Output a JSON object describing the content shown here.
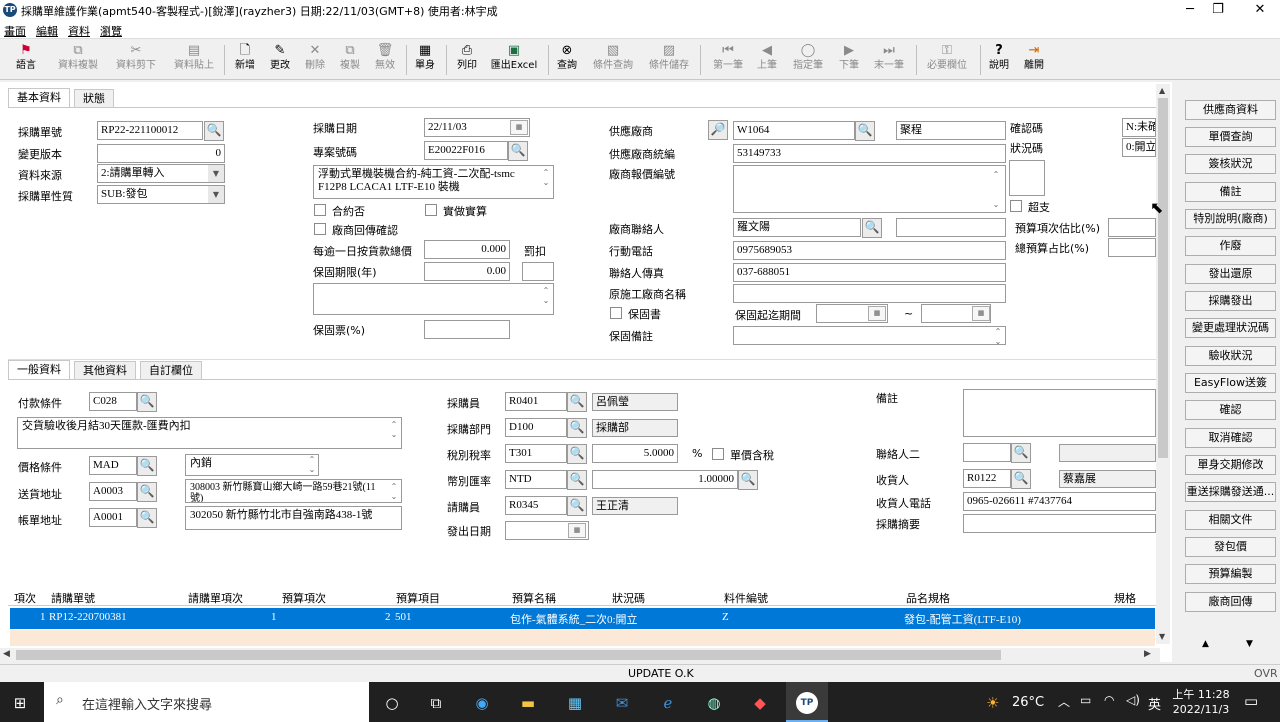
{
  "window": {
    "title": "採購單維護作業(apmt540-客製程式-)[銳澤](rayzher3) 日期:22/11/03(GMT+8) 使用者:林宇成",
    "app_icon": "TP",
    "minimize": "─",
    "maximize": "❐",
    "close": "✕"
  },
  "menu": [
    "畫面",
    "編輯",
    "資料",
    "瀏覽"
  ],
  "toolbar": [
    {
      "label": "語言",
      "icon": "flag-icon",
      "glyph": "⚑",
      "disabled": false
    },
    {
      "label": "資料複製",
      "icon": "copy-icon",
      "glyph": "⧉",
      "disabled": true
    },
    {
      "label": "資料剪下",
      "icon": "scissors-icon",
      "glyph": "✂",
      "disabled": true
    },
    {
      "label": "資料貼上",
      "icon": "paste-icon",
      "glyph": "▤",
      "disabled": true
    },
    {
      "label": "新增",
      "icon": "new-doc-icon",
      "glyph": "🗋",
      "disabled": false
    },
    {
      "label": "更改",
      "icon": "pencil-icon",
      "glyph": "✎",
      "disabled": false
    },
    {
      "label": "刪除",
      "icon": "delete-x-icon",
      "glyph": "✕",
      "disabled": true
    },
    {
      "label": "複製",
      "icon": "duplicate-icon",
      "glyph": "⧉",
      "disabled": true
    },
    {
      "label": "無效",
      "icon": "trash-icon",
      "glyph": "🗑",
      "disabled": true
    },
    {
      "label": "單身",
      "icon": "detail-icon",
      "glyph": "▦",
      "disabled": false
    },
    {
      "label": "列印",
      "icon": "printer-icon",
      "glyph": "⎙",
      "disabled": false
    },
    {
      "label": "匯出Excel",
      "icon": "excel-icon",
      "glyph": "▣",
      "disabled": false
    },
    {
      "label": "查詢",
      "icon": "binoculars-icon",
      "glyph": "⊗",
      "disabled": false
    },
    {
      "label": "條件查詢",
      "icon": "filter-search-icon",
      "glyph": "▧",
      "disabled": true
    },
    {
      "label": "條件儲存",
      "icon": "filter-save-icon",
      "glyph": "▨",
      "disabled": true
    },
    {
      "label": "第一筆",
      "icon": "first-record-icon",
      "glyph": "⏮",
      "disabled": true
    },
    {
      "label": "上筆",
      "icon": "previous-record-icon",
      "glyph": "◀",
      "disabled": true
    },
    {
      "label": "指定筆",
      "icon": "goto-record-icon",
      "glyph": "◯",
      "disabled": true
    },
    {
      "label": "下筆",
      "icon": "next-record-icon",
      "glyph": "▶",
      "disabled": true
    },
    {
      "label": "末一筆",
      "icon": "last-record-icon",
      "glyph": "⏭",
      "disabled": true
    },
    {
      "label": "必要欄位",
      "icon": "key-icon",
      "glyph": "⚿",
      "disabled": true
    },
    {
      "label": "說明",
      "icon": "help-icon",
      "glyph": "?",
      "disabled": false
    },
    {
      "label": "離開",
      "icon": "exit-icon",
      "glyph": "⇥",
      "disabled": false
    }
  ],
  "tabs_top": [
    "基本資料",
    "狀態"
  ],
  "tabs_mid": [
    "一般資料",
    "其他資料",
    "自訂欄位"
  ],
  "form": {
    "po_no_label": "採購單號",
    "po_no": "RP22-221100012",
    "version_label": "變更版本",
    "version": "0",
    "source_label": "資料來源",
    "source": "2:請購單轉入",
    "nature_label": "採購單性質",
    "nature": "SUB:發包",
    "date_label": "採購日期",
    "date": "22/11/03",
    "project_label": "專案號碼",
    "project": "E20022F016",
    "project_desc": "浮動式單機裝機合約-純工資-二次配-tsmc F12P8 LCACA1 LTF-E10 裝機",
    "contract_label": "合約否",
    "actual_label": "實做實算",
    "reply_label": "廠商回傳確認",
    "daily_label": "每逾一日按貨款總價",
    "daily": "0.000",
    "penalty_label": "罰扣",
    "warranty_label": "保固期限(年)",
    "warranty": "0.00",
    "warranty_pct_label": "保固票(%)",
    "supplier_label": "供應廠商",
    "supplier_code": "W1064",
    "supplier_name": "聚程",
    "supplier_id_label": "供應廠商統編",
    "supplier_id": "53149733",
    "quote_label": "廠商報價編號",
    "contact_label": "廠商聯絡人",
    "contact": "羅文陽",
    "mobile_label": "行動電話",
    "mobile": "0975689053",
    "fax_label": "聯絡人傳真",
    "fax": "037-688051",
    "orig_label": "原施工廠商名稱",
    "warranty_doc_label": "保固書",
    "warranty_period_label": "保固起迄期間",
    "tilde": "~",
    "warranty_note_label": "保固備註",
    "confirm_label": "確認碼",
    "confirm": "N:未確",
    "status_label": "狀況碼",
    "status": "0:開立",
    "over_label": "超支",
    "budget_est_label": "預算項次估比(%)",
    "budget_total_label": "總預算占比(%)"
  },
  "general": {
    "pay_label": "付款條件",
    "pay_code": "C028",
    "pay_desc": "交貨驗收後月結30天匯款-匯費內扣",
    "price_label": "價格條件",
    "price_code": "MAD",
    "price_desc": "內銷",
    "ship_label": "送貨地址",
    "ship_code": "A0003",
    "ship_addr": "308003 新竹縣寶山鄉大崎一路59巷21號(11號)",
    "bill_label": "帳單地址",
    "bill_code": "A0001",
    "bill_addr": "302050 新竹縣竹北市自強南路438-1號",
    "buyer_label": "採購員",
    "buyer_code": "R0401",
    "buyer_name": "呂佩瑩",
    "dept_label": "採購部門",
    "dept_code": "D100",
    "dept_name": "採購部",
    "tax_label": "稅別稅率",
    "tax_code": "T301",
    "tax_rate": "5.0000",
    "pct": "%",
    "tax_incl_label": "單價含稅",
    "curr_label": "幣別匯率",
    "curr": "NTD",
    "rate": "1.00000",
    "req_label": "請購員",
    "req_code": "R0345",
    "req_name": "王正清",
    "issue_label": "發出日期",
    "note_label": "備註",
    "contact2_label": "聯絡人二",
    "recv_label": "收貨人",
    "recv_code": "R0122",
    "recv_name": "蔡嘉展",
    "recv_phone_label": "收貨人電話",
    "recv_phone": "0965-026611 #7437764",
    "summary_label": "採購摘要"
  },
  "grid": {
    "headers": [
      "項次",
      "請購單號",
      "請購單項次",
      "預算項次",
      "預算項目",
      "預算名稱",
      "狀況碼",
      "料件編號",
      "品名規格",
      "規格"
    ],
    "row": [
      "1",
      "RP12-220700381",
      "1",
      "2",
      "501",
      "包作-氣體系統_二次",
      "0:開立",
      "Z",
      "發包-配管工資(LTF-E10)"
    ]
  },
  "right_buttons": [
    "供應商資料",
    "單價查詢",
    "簽核狀況",
    "備註",
    "特別說明(廠商)",
    "作廢",
    "發出還原",
    "採購發出",
    "變更處理狀況碼",
    "驗收狀況",
    "EasyFlow送簽",
    "確認",
    "取消確認",
    "單身交期修改",
    "重送採購發送通...",
    "相關文件",
    "發包價",
    "預算編製",
    "廠商回傳"
  ],
  "status": {
    "message": "UPDATE O.K",
    "ovr": "OVR"
  },
  "taskbar": {
    "search_placeholder": "在這裡輸入文字來搜尋",
    "weather": "26°C",
    "lang": "英",
    "time": "上午 11:28",
    "date": "2022/11/3"
  }
}
